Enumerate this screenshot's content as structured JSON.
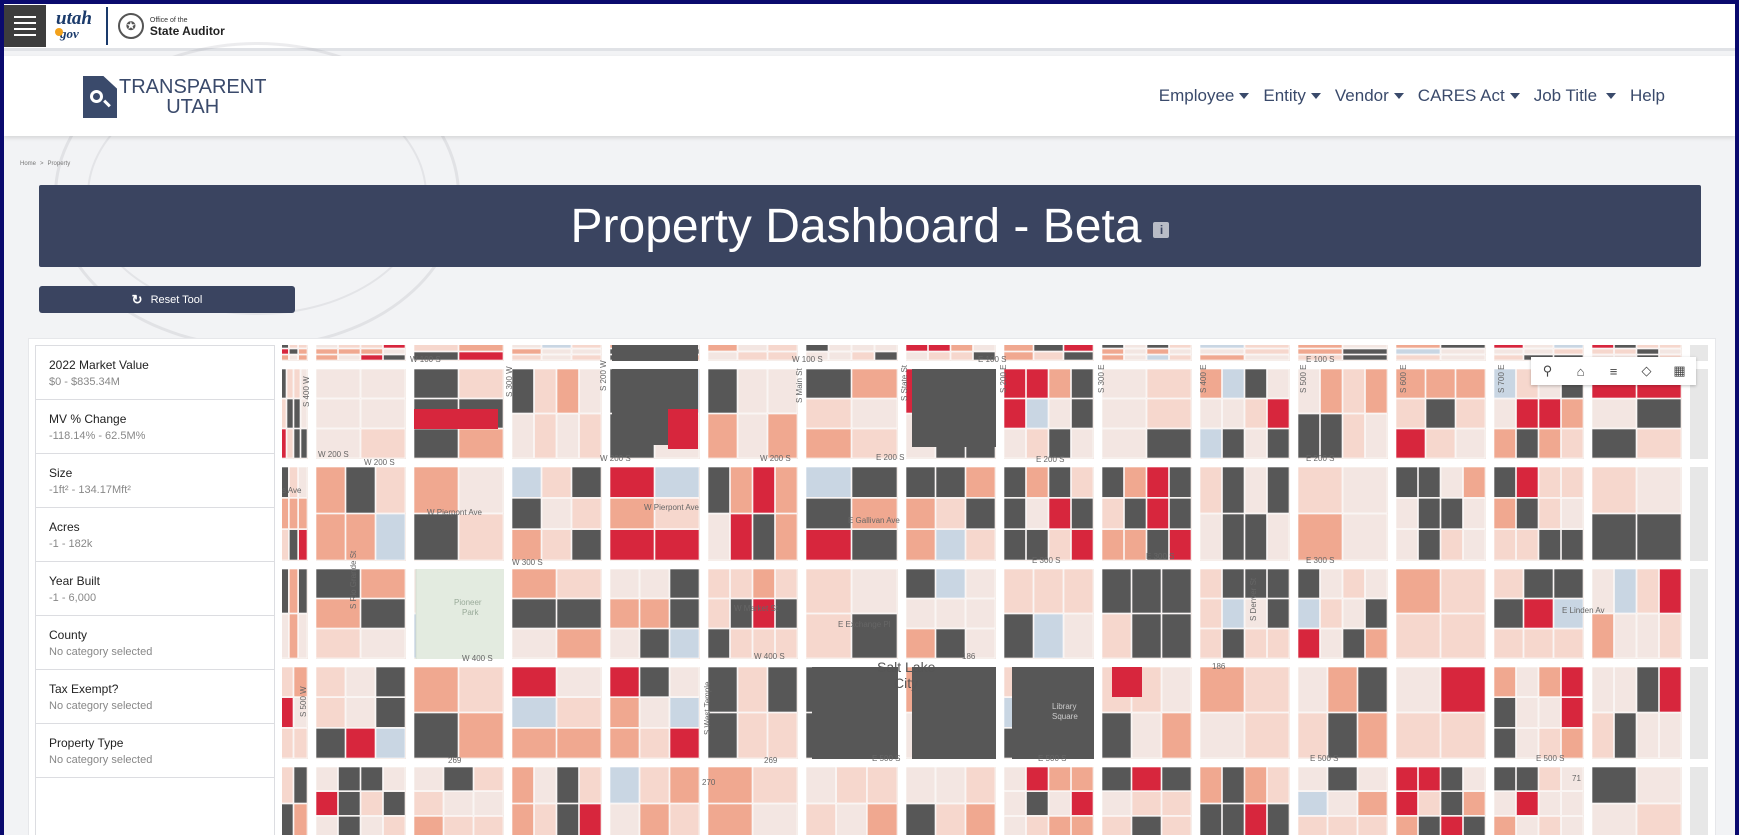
{
  "statebar": {
    "utah_text": "utah",
    "gov_text": "gov",
    "office_small": "Office of the",
    "office_name": "State Auditor"
  },
  "header": {
    "logo_line1": "TRANSPARENT",
    "logo_line2": "UTAH",
    "nav": [
      {
        "label": "Employee"
      },
      {
        "label": "Entity"
      },
      {
        "label": "Vendor"
      },
      {
        "label": "CARES Act"
      },
      {
        "label": "Job Title"
      },
      {
        "label": "Help"
      }
    ]
  },
  "breadcrumb": {
    "home": "Home",
    "separator": ">",
    "current": "Property"
  },
  "page": {
    "title": "Property Dashboard - Beta",
    "info_glyph": "i",
    "reset_label": "Reset Tool"
  },
  "filters": [
    {
      "label": "2022 Market Value",
      "value": "$0 - $835.34M"
    },
    {
      "label": "MV % Change",
      "value": "-118.14% - 62.5M%"
    },
    {
      "label": "Size",
      "value": "-1ft² - 134.17Mft²"
    },
    {
      "label": "Acres",
      "value": "-1 - 182k"
    },
    {
      "label": "Year Built",
      "value": "-1 - 6,000"
    },
    {
      "label": "County",
      "value": "No category selected"
    },
    {
      "label": "Tax Exempt?",
      "value": "No category selected"
    },
    {
      "label": "Property Type",
      "value": "No category selected"
    }
  ],
  "map": {
    "city_label_1": "Salt Lake",
    "city_label_2": "City",
    "street_labels": {
      "w100s": "W 100 S",
      "w100s_b": "W 100 S",
      "e100s": "E 100 S",
      "e100s_b": "E 100 S",
      "w200s": "W 200 S",
      "w200s_b": "W 200 S",
      "w200s_c": "W 200 S",
      "e200s": "E 200 S",
      "e200s_b": "E 200 S",
      "e200s_c": "E 200 S",
      "w300s": "W 300 S",
      "e300s": "E 300 S",
      "e300s_b": "E 300 S",
      "e300s_c": "E 300 S",
      "w400s": "W 400 S",
      "w400s_b": "W 400 S",
      "e500s": "E 500 S",
      "e500s_b": "E 500 S",
      "e500s_c": "E 500 S",
      "e500s_d": "E 500 S",
      "pierpont_w": "W Pierpont Ave",
      "pierpont_w2": "W Pierpont Ave",
      "gallivan": "E Gallivan Ave",
      "market": "W Market St",
      "exchange": "E Exchange Pl",
      "pioneer_park_1": "Pioneer",
      "pioneer_park_2": "Park",
      "library_1": "Library",
      "library_2": "Square",
      "s_state": "S State St",
      "s_main": "S Main St",
      "s_west_temple": "S West Temple",
      "s_300w": "S 300 W",
      "s_200w": "S 200 W",
      "s_400w": "S 400 W",
      "s_500w": "S 500 W",
      "s_200e": "S 200 E",
      "s_300e": "S 300 E",
      "s_400e": "S 400 E",
      "s_500e": "S 500 E",
      "s_600e": "S 600 E",
      "s_700e": "S 700 E",
      "rio_grande": "S Rio Grande St",
      "e_linden": "E Linden Av",
      "s_denver": "S Denver St",
      "route_186": "186",
      "route_186_b": "186",
      "route_269": "269",
      "route_269_b": "269",
      "route_270": "270",
      "route_71": "71",
      "ave_edge": "s Ave"
    },
    "legend_colors": {
      "dark": "#575757",
      "red": "#d7263d",
      "salmon": "#f0a890",
      "pale": "#f6d7cd",
      "light": "#f3e6e2",
      "blue": "#c9d6e3",
      "road": "#ffffff",
      "park": "#e3ebe0"
    },
    "tools": [
      "search-icon",
      "home-icon",
      "list-icon",
      "layers-icon",
      "grid-icon"
    ]
  }
}
